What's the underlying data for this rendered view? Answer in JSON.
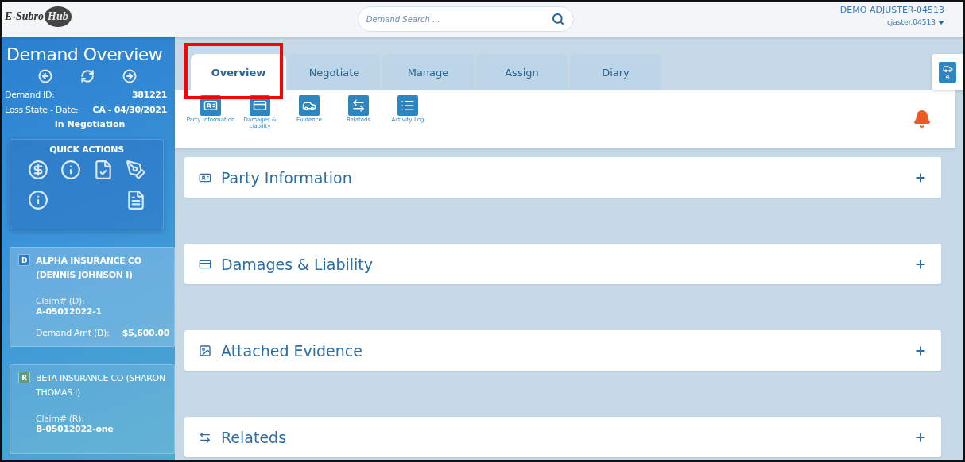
{
  "header": {
    "logo": {
      "part_1": "E-Subro",
      "part_2": "Hub"
    },
    "search": {
      "placeholder": "Demand Search ..."
    },
    "user": {
      "name": "DEMO ADJUSTER-04513",
      "login": "cjaster.04513"
    }
  },
  "sidebar": {
    "title": "Demand Overview",
    "details": [
      {
        "label": "Demand ID:",
        "value": "381221"
      },
      {
        "label": "Loss State - Date:",
        "value": "CA - 04/30/2021"
      }
    ],
    "status": "In Negotiation",
    "quick_actions": {
      "title": "QUICK ACTIONS",
      "items": [
        {
          "kind": "payment"
        },
        {
          "kind": "info-back"
        },
        {
          "kind": "document"
        },
        {
          "kind": "sign"
        },
        {
          "kind": "info-forward"
        },
        {
          "kind": "spacer"
        },
        {
          "kind": "spacer"
        },
        {
          "kind": "fyi"
        }
      ]
    },
    "parties": [
      {
        "badge": "D",
        "color": "#2f7bbf",
        "name": "ALPHA INSURANCE CO (DENNIS JOHNSON I)",
        "selected": true,
        "claim_label": "Claim# (D):",
        "claim": "A-05012022-1",
        "amount_label": "Demand Amt (D):",
        "amount": "$5,600.00"
      },
      {
        "badge": "R",
        "color": "#5e9e7e",
        "name": "BETA INSURANCE CO (SHARON THOMAS I)",
        "selected": false,
        "claim_label": "Claim# (R):",
        "claim": "B-05012022-one"
      }
    ]
  },
  "tabs": [
    {
      "label": "Overview",
      "selected": true,
      "highlighted": true
    },
    {
      "label": "Negotiate",
      "selected": false,
      "highlighted": false
    },
    {
      "label": "Manage",
      "selected": false,
      "highlighted": false
    },
    {
      "label": "Assign",
      "selected": false,
      "highlighted": false
    },
    {
      "label": "Diary",
      "selected": false,
      "highlighted": false
    }
  ],
  "toolbar": [
    {
      "kind": "party",
      "label": "Party Information"
    },
    {
      "kind": "damages",
      "label": "Damages & Liability"
    },
    {
      "kind": "evidence",
      "label": "Evidence"
    },
    {
      "kind": "relateds",
      "label": "Relateds"
    },
    {
      "kind": "log",
      "label": "Activity Log"
    }
  ],
  "evidence_button": {
    "count": "4"
  },
  "sections": [
    {
      "kind": "party",
      "title": "Party Information",
      "expanded": false
    },
    {
      "kind": "damages",
      "title": "Damages & Liability",
      "expanded": false
    },
    {
      "kind": "evidence",
      "title": "Attached Evidence",
      "expanded": false
    },
    {
      "kind": "relateds",
      "title": "Relateds",
      "expanded": false
    }
  ]
}
